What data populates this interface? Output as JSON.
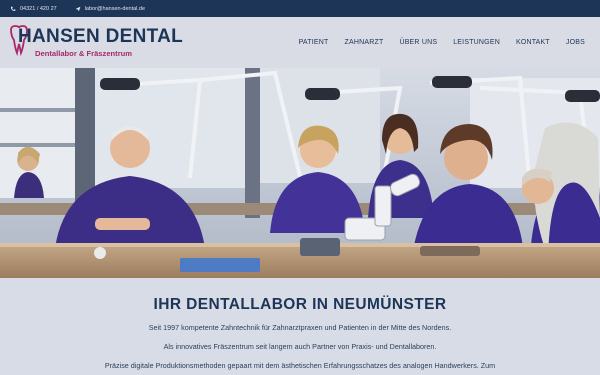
{
  "topbar": {
    "phone": "04321 / 420 27",
    "email": "labor@hansen-dental.de",
    "phone_icon": "phone-icon",
    "email_icon": "send-icon"
  },
  "logo": {
    "title": "HANSEN DENTAL",
    "subtitle": "Dentallabor & Fräszentrum",
    "icon": "tooth-icon"
  },
  "nav": {
    "items": [
      "PATIENT",
      "ZAHNARZT",
      "ÜBER UNS",
      "LEISTUNGEN",
      "KONTAKT",
      "JOBS"
    ]
  },
  "main": {
    "headline": "IHR DENTALLABOR IN NEUMÜNSTER",
    "paragraphs": [
      "Seit 1997 kompetente Zahntechnik für Zahnarztpraxen und Patienten in der Mitte des Nordens.",
      "Als innovatives Fräszentrum seit langem auch Partner von Praxis- und Dentallaboren.",
      "Präzise digitale Produktionsmethoden gepaart mit dem ästhetischen Erfahrungsschatzes des analogen Handwerkers. Zum"
    ]
  },
  "colors": {
    "navy": "#1d3556",
    "magenta": "#a8286a",
    "background": "#d8dce6"
  }
}
